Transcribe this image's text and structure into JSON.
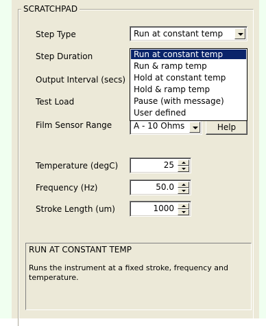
{
  "groupbox": {
    "title": "SCRATCHPAD"
  },
  "fields": {
    "step_type": {
      "label": "Step Type",
      "value": "Run at constant temp"
    },
    "step_duration": {
      "label": "Step Duration"
    },
    "output_interval": {
      "label": "Output Interval (secs)"
    },
    "test_load": {
      "label": "Test Load"
    },
    "film_sensor_range": {
      "label": "Film Sensor Range",
      "value": "A - 10 Ohms",
      "help_label": "Help"
    },
    "temperature": {
      "label": "Temperature (degC)",
      "value": "25"
    },
    "frequency": {
      "label": "Frequency (Hz)",
      "value": "50.0"
    },
    "stroke_length": {
      "label": "Stroke Length (um)",
      "value": "1000"
    }
  },
  "step_type_options": [
    "Run at constant temp",
    "Run & ramp temp",
    "Hold at constant temp",
    "Hold & ramp temp",
    "Pause (with message)",
    "User defined"
  ],
  "description": {
    "title": "RUN AT CONSTANT TEMP",
    "body": "Runs the instrument at a fixed stroke, frequency and temperature."
  },
  "colors": {
    "background_strip": "#f0fff0",
    "panel": "#ece9d8",
    "highlight": "#0a246a"
  }
}
